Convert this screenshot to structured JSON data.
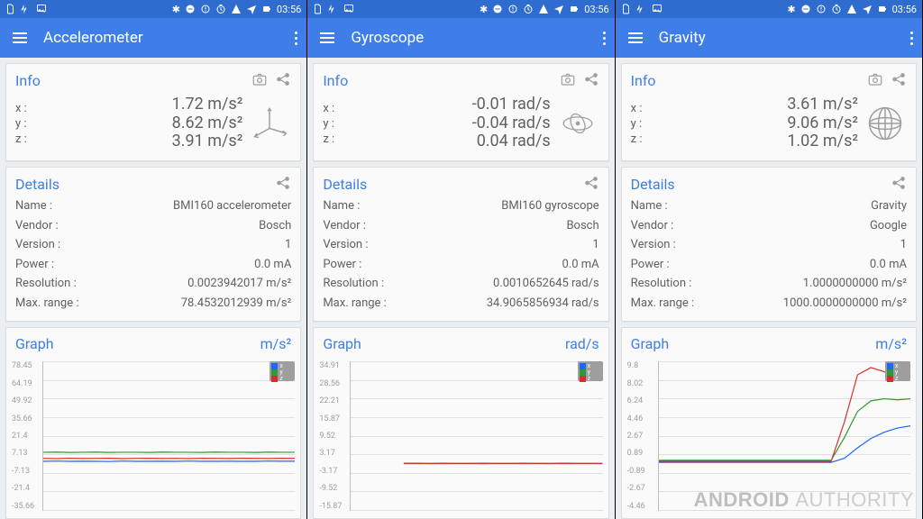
{
  "status": {
    "time": "03:56"
  },
  "watermark": {
    "a": "ANDROID ",
    "b": "AUTHORITY"
  },
  "screens": [
    {
      "title": "Accelerometer",
      "info_title": "Info",
      "axes": {
        "x_lbl": "x :",
        "y_lbl": "y :",
        "z_lbl": "z :",
        "x": "1.72 m/s²",
        "y": "8.62 m/s²",
        "z": "3.91 m/s²"
      },
      "details_title": "Details",
      "details": {
        "name_lbl": "Name :",
        "name": "BMI160 accelerometer",
        "vendor_lbl": "Vendor :",
        "vendor": "Bosch",
        "version_lbl": "Version :",
        "version": "1",
        "power_lbl": "Power :",
        "power": "0.0 mA",
        "res_lbl": "Resolution :",
        "res": "0.0023942017 m/s²",
        "range_lbl": "Max. range :",
        "range": "78.4532012939 m/s²"
      },
      "graph": {
        "title": "Graph",
        "unit": "m/s²",
        "ticks": [
          "78.45",
          "64.19",
          "49.92",
          "35.66",
          "21.4",
          "7.13",
          "-7.13",
          "-21.4",
          "-35.66"
        ]
      }
    },
    {
      "title": "Gyroscope",
      "info_title": "Info",
      "axes": {
        "x_lbl": "x :",
        "y_lbl": "y :",
        "z_lbl": "z :",
        "x": "-0.01 rad/s",
        "y": "-0.04 rad/s",
        "z": "0.04 rad/s"
      },
      "details_title": "Details",
      "details": {
        "name_lbl": "Name :",
        "name": "BMI160 gyroscope",
        "vendor_lbl": "Vendor :",
        "vendor": "Bosch",
        "version_lbl": "Version :",
        "version": "1",
        "power_lbl": "Power :",
        "power": "0.0 mA",
        "res_lbl": "Resolution :",
        "res": "0.0010652645 rad/s",
        "range_lbl": "Max. range :",
        "range": "34.9065856934 rad/s"
      },
      "graph": {
        "title": "Graph",
        "unit": "rad/s",
        "ticks": [
          "34.91",
          "28.56",
          "22.21",
          "15.87",
          "9.52",
          "3.17",
          "-3.17",
          "-9.52",
          "-15.87"
        ]
      }
    },
    {
      "title": "Gravity",
      "info_title": "Info",
      "axes": {
        "x_lbl": "x :",
        "y_lbl": "y :",
        "z_lbl": "z :",
        "x": "3.61 m/s²",
        "y": "9.06 m/s²",
        "z": "1.02 m/s²"
      },
      "details_title": "Details",
      "details": {
        "name_lbl": "Name :",
        "name": "Gravity",
        "vendor_lbl": "Vendor :",
        "vendor": "Google",
        "version_lbl": "Version :",
        "version": "1",
        "power_lbl": "Power :",
        "power": "0.0 mA",
        "res_lbl": "Resolution :",
        "res": "1.0000000000 m/s²",
        "range_lbl": "Max. range :",
        "range": "1000.0000000000 m/s²"
      },
      "graph": {
        "title": "Graph",
        "unit": "m/s²",
        "ticks": [
          "9.8",
          "8.02",
          "6.24",
          "4.46",
          "2.67",
          "0.89",
          "-0.89",
          "-2.67",
          "-4.46"
        ]
      }
    }
  ],
  "chart_data": [
    {
      "type": "line",
      "title": "Accelerometer",
      "ylabel": "m/s²",
      "ylim": [
        -35.66,
        78.45
      ],
      "x": [
        0,
        1,
        2,
        3,
        4,
        5,
        6,
        7,
        8,
        9,
        10,
        11,
        12,
        13,
        14,
        15,
        16,
        17,
        18,
        19
      ],
      "series": [
        {
          "name": "x",
          "color": "#1e66ff",
          "values": [
            1.7,
            1.9,
            1.6,
            1.8,
            1.7,
            1.5,
            1.9,
            1.7,
            1.6,
            1.8,
            1.7,
            1.9,
            1.6,
            1.7,
            1.8,
            1.6,
            1.7,
            1.9,
            1.8,
            1.72
          ]
        },
        {
          "name": "y",
          "color": "#2e9b2e",
          "values": [
            8.6,
            8.7,
            8.5,
            8.6,
            8.7,
            8.5,
            8.6,
            8.6,
            8.5,
            8.7,
            8.6,
            8.6,
            8.5,
            8.7,
            8.6,
            8.6,
            8.5,
            8.7,
            8.6,
            8.62
          ]
        },
        {
          "name": "z",
          "color": "#d42f2f",
          "values": [
            3.9,
            3.7,
            4.1,
            3.8,
            3.9,
            4.0,
            3.7,
            3.9,
            4.0,
            3.8,
            3.9,
            3.7,
            4.0,
            3.9,
            3.8,
            4.1,
            3.9,
            3.8,
            4.0,
            3.91
          ]
        }
      ]
    },
    {
      "type": "line",
      "title": "Gyroscope",
      "ylabel": "rad/s",
      "ylim": [
        -15.87,
        34.91
      ],
      "x": [
        0,
        1,
        2,
        3,
        4,
        5,
        6,
        7,
        8,
        9,
        10,
        11,
        12,
        13,
        14,
        15,
        16,
        17,
        18,
        19
      ],
      "series": [
        {
          "name": "x",
          "color": "#1e66ff",
          "values": [
            null,
            null,
            null,
            null,
            0,
            0.05,
            -0.02,
            0.01,
            0,
            0.03,
            -0.01,
            0.02,
            0,
            0.01,
            0,
            -0.02,
            0.03,
            0,
            0.01,
            -0.01
          ]
        },
        {
          "name": "y",
          "color": "#2e9b2e",
          "values": [
            null,
            null,
            null,
            null,
            -0.03,
            -0.05,
            -0.02,
            -0.04,
            -0.03,
            -0.05,
            -0.04,
            -0.03,
            -0.04,
            -0.05,
            -0.03,
            -0.04,
            -0.03,
            -0.05,
            -0.04,
            -0.04
          ]
        },
        {
          "name": "z",
          "color": "#d42f2f",
          "values": [
            null,
            null,
            null,
            null,
            0.05,
            0.03,
            0.04,
            0.06,
            0.04,
            0.03,
            0.05,
            0.04,
            0.03,
            0.05,
            0.04,
            0.03,
            0.05,
            0.04,
            0.03,
            0.04
          ]
        }
      ]
    },
    {
      "type": "line",
      "title": "Gravity",
      "ylabel": "m/s²",
      "ylim": [
        -4.46,
        9.8
      ],
      "x": [
        0,
        1,
        2,
        3,
        4,
        5,
        6,
        7,
        8,
        9,
        10,
        11,
        12,
        13,
        14,
        15,
        16,
        17,
        18,
        19
      ],
      "series": [
        {
          "name": "x",
          "color": "#1e66ff",
          "values": [
            0.1,
            0.1,
            0.1,
            0.1,
            0.1,
            0.1,
            0.1,
            0.1,
            0.1,
            0.1,
            0.1,
            0.1,
            0.1,
            0.1,
            0.5,
            1.5,
            2.4,
            3.0,
            3.4,
            3.61
          ]
        },
        {
          "name": "y",
          "color": "#2e9b2e",
          "values": [
            0.3,
            0.3,
            0.3,
            0.3,
            0.3,
            0.3,
            0.3,
            0.3,
            0.3,
            0.3,
            0.3,
            0.3,
            0.3,
            0.3,
            2.5,
            5.0,
            6.0,
            6.2,
            6.1,
            6.2
          ]
        },
        {
          "name": "z",
          "color": "#d42f2f",
          "values": [
            0.2,
            0.2,
            0.2,
            0.2,
            0.2,
            0.2,
            0.2,
            0.2,
            0.2,
            0.2,
            0.2,
            0.2,
            0.2,
            0.2,
            4.0,
            8.5,
            9.2,
            8.8,
            8.0,
            8.4
          ]
        }
      ]
    }
  ]
}
